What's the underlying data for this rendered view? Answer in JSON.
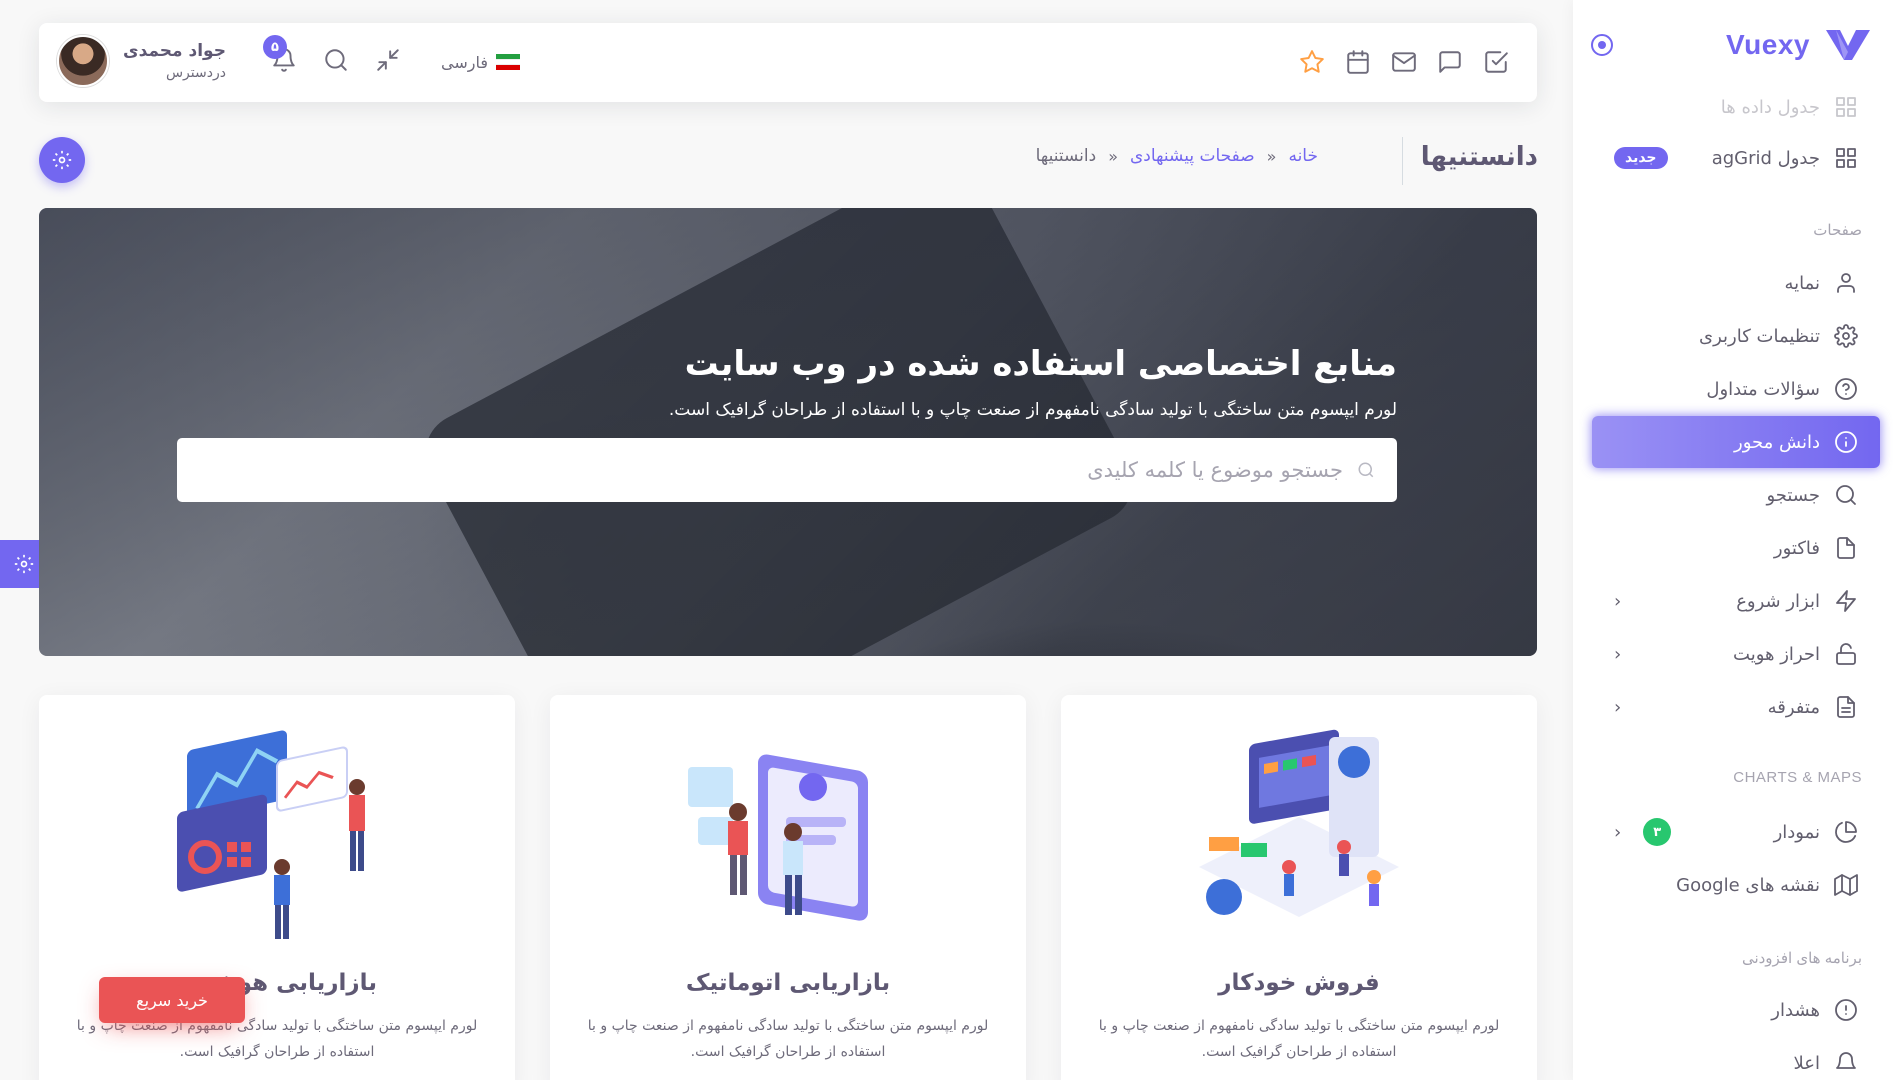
{
  "brand": {
    "name": "Vuexy",
    "accent": "#7367f0"
  },
  "sidebar": {
    "faded_item": "جدول داده ها",
    "aggrid": {
      "label": "جدول agGrid",
      "badge": "جدید"
    },
    "section_pages": "صفحات",
    "items": [
      {
        "label": "نمایه",
        "icon": "user-icon"
      },
      {
        "label": "تنظیمات کاربری",
        "icon": "gear-icon"
      },
      {
        "label": "سؤالات متداول",
        "icon": "help-circle-icon"
      },
      {
        "label": "دانش محور",
        "icon": "info-icon",
        "active": true
      },
      {
        "label": "جستجو",
        "icon": "search-icon"
      },
      {
        "label": "فاکتور",
        "icon": "file-icon"
      },
      {
        "label": "ابزار شروع",
        "icon": "zap-icon",
        "submenu": true
      },
      {
        "label": "احراز هویت",
        "icon": "unlock-icon",
        "submenu": true
      },
      {
        "label": "متفرقه",
        "icon": "file-text-icon",
        "submenu": true
      }
    ],
    "section_charts": "CHARTS & MAPS",
    "charts": {
      "label": "نمودار",
      "badge": "۳"
    },
    "maps": {
      "label": "نقشه های Google"
    },
    "section_extensions": "برنامه های افزودنی",
    "alert": {
      "label": "هشدار"
    },
    "partial": {
      "label": "اعلا"
    }
  },
  "navbar": {
    "language": "فارسی",
    "notifications_count": "۵",
    "user": {
      "name": "جواد محمدی",
      "role": "دردسترس"
    },
    "icons": [
      "check-square-icon",
      "message-icon",
      "mail-icon",
      "calendar-icon",
      "star-icon"
    ]
  },
  "breadcrumb": {
    "title": "دانستنیها",
    "home": "خانه",
    "parent": "صفحات پیشنهادی",
    "current": "دانستنیها"
  },
  "hero": {
    "title": "منابع اختصاصی استفاده شده در وب سایت",
    "subtitle": "لورم ایپسوم متن ساختگی با تولید سادگی نامفهوم از صنعت چاپ و با استفاده از طراحان گرافیک است.",
    "search_placeholder": "جستجو موضوع یا کلمه کلیدی"
  },
  "cards": [
    {
      "title": "فروش خودکار",
      "text": "لورم ایپسوم متن ساختگی با تولید سادگی نامفهوم از صنعت چاپ و با استفاده از طراحان گرافیک است."
    },
    {
      "title": "بازاریابی اتوماتیک",
      "text": "لورم ایپسوم متن ساختگی با تولید سادگی نامفهوم از صنعت چاپ و با استفاده از طراحان گرافیک است."
    },
    {
      "title": "بازاریابی هوشمند",
      "text": "لورم ایپسوم متن ساختگی با تولید سادگی نامفهوم از صنعت چاپ و با استفاده از طراحان گرافیک است."
    }
  ],
  "buy_button": "خرید سریع",
  "colors": {
    "accent": "#7367f0",
    "danger": "#ea5455",
    "success": "#28c76f",
    "warning": "#ff9f43"
  }
}
